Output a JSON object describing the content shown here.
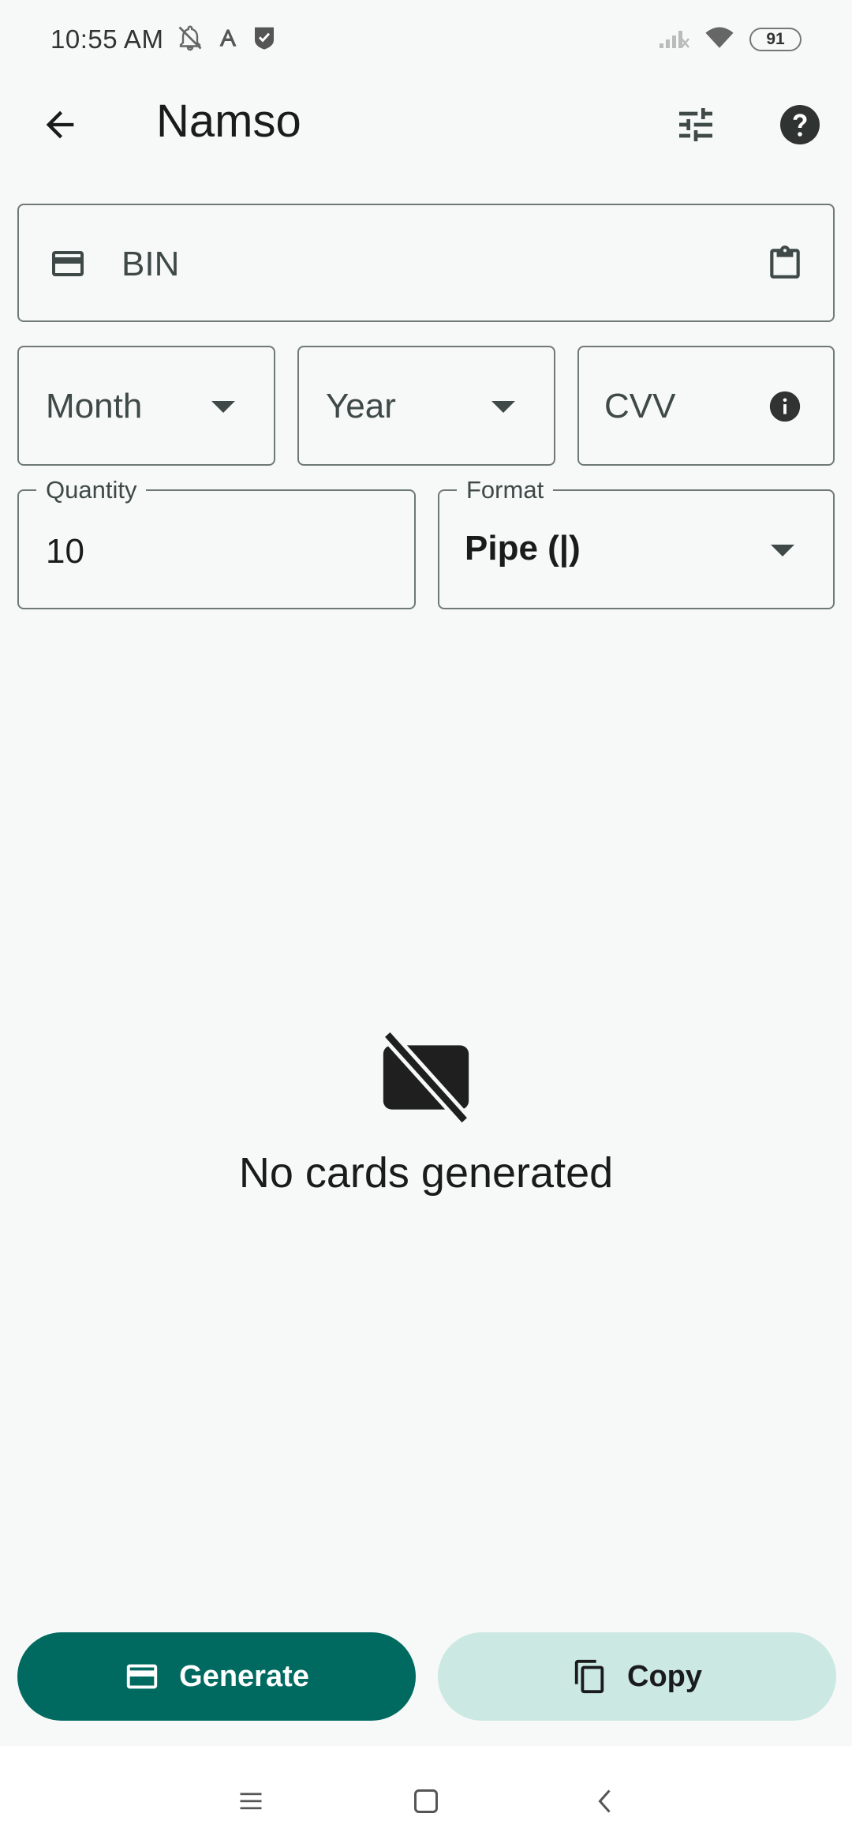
{
  "status_bar": {
    "time": "10:55 AM",
    "battery": "91",
    "icons": [
      "notifications-off-icon",
      "text-icon",
      "shield-check-icon",
      "signal-icon",
      "wifi-icon",
      "battery-icon"
    ]
  },
  "app_bar": {
    "title": "Namso",
    "back_icon": "arrow-back-icon",
    "tune_icon": "tune-icon",
    "help_icon": "help-icon"
  },
  "form": {
    "bin": {
      "placeholder": "BIN",
      "leading_icon": "credit-card-icon",
      "trailing_icon": "clipboard-icon"
    },
    "month": {
      "placeholder": "Month"
    },
    "year": {
      "placeholder": "Year"
    },
    "cvv": {
      "placeholder": "CVV",
      "trailing_icon": "info-icon"
    },
    "quantity": {
      "label": "Quantity",
      "value": "10"
    },
    "format": {
      "label": "Format",
      "value": "Pipe (|)"
    }
  },
  "empty_state": {
    "icon": "card-off-icon",
    "text": "No cards generated"
  },
  "actions": {
    "generate_label": "Generate",
    "copy_label": "Copy"
  },
  "colors": {
    "primary": "#006a60",
    "secondary_container": "#cce8e3",
    "background": "#f6f9f8",
    "outline": "#6f7977"
  }
}
